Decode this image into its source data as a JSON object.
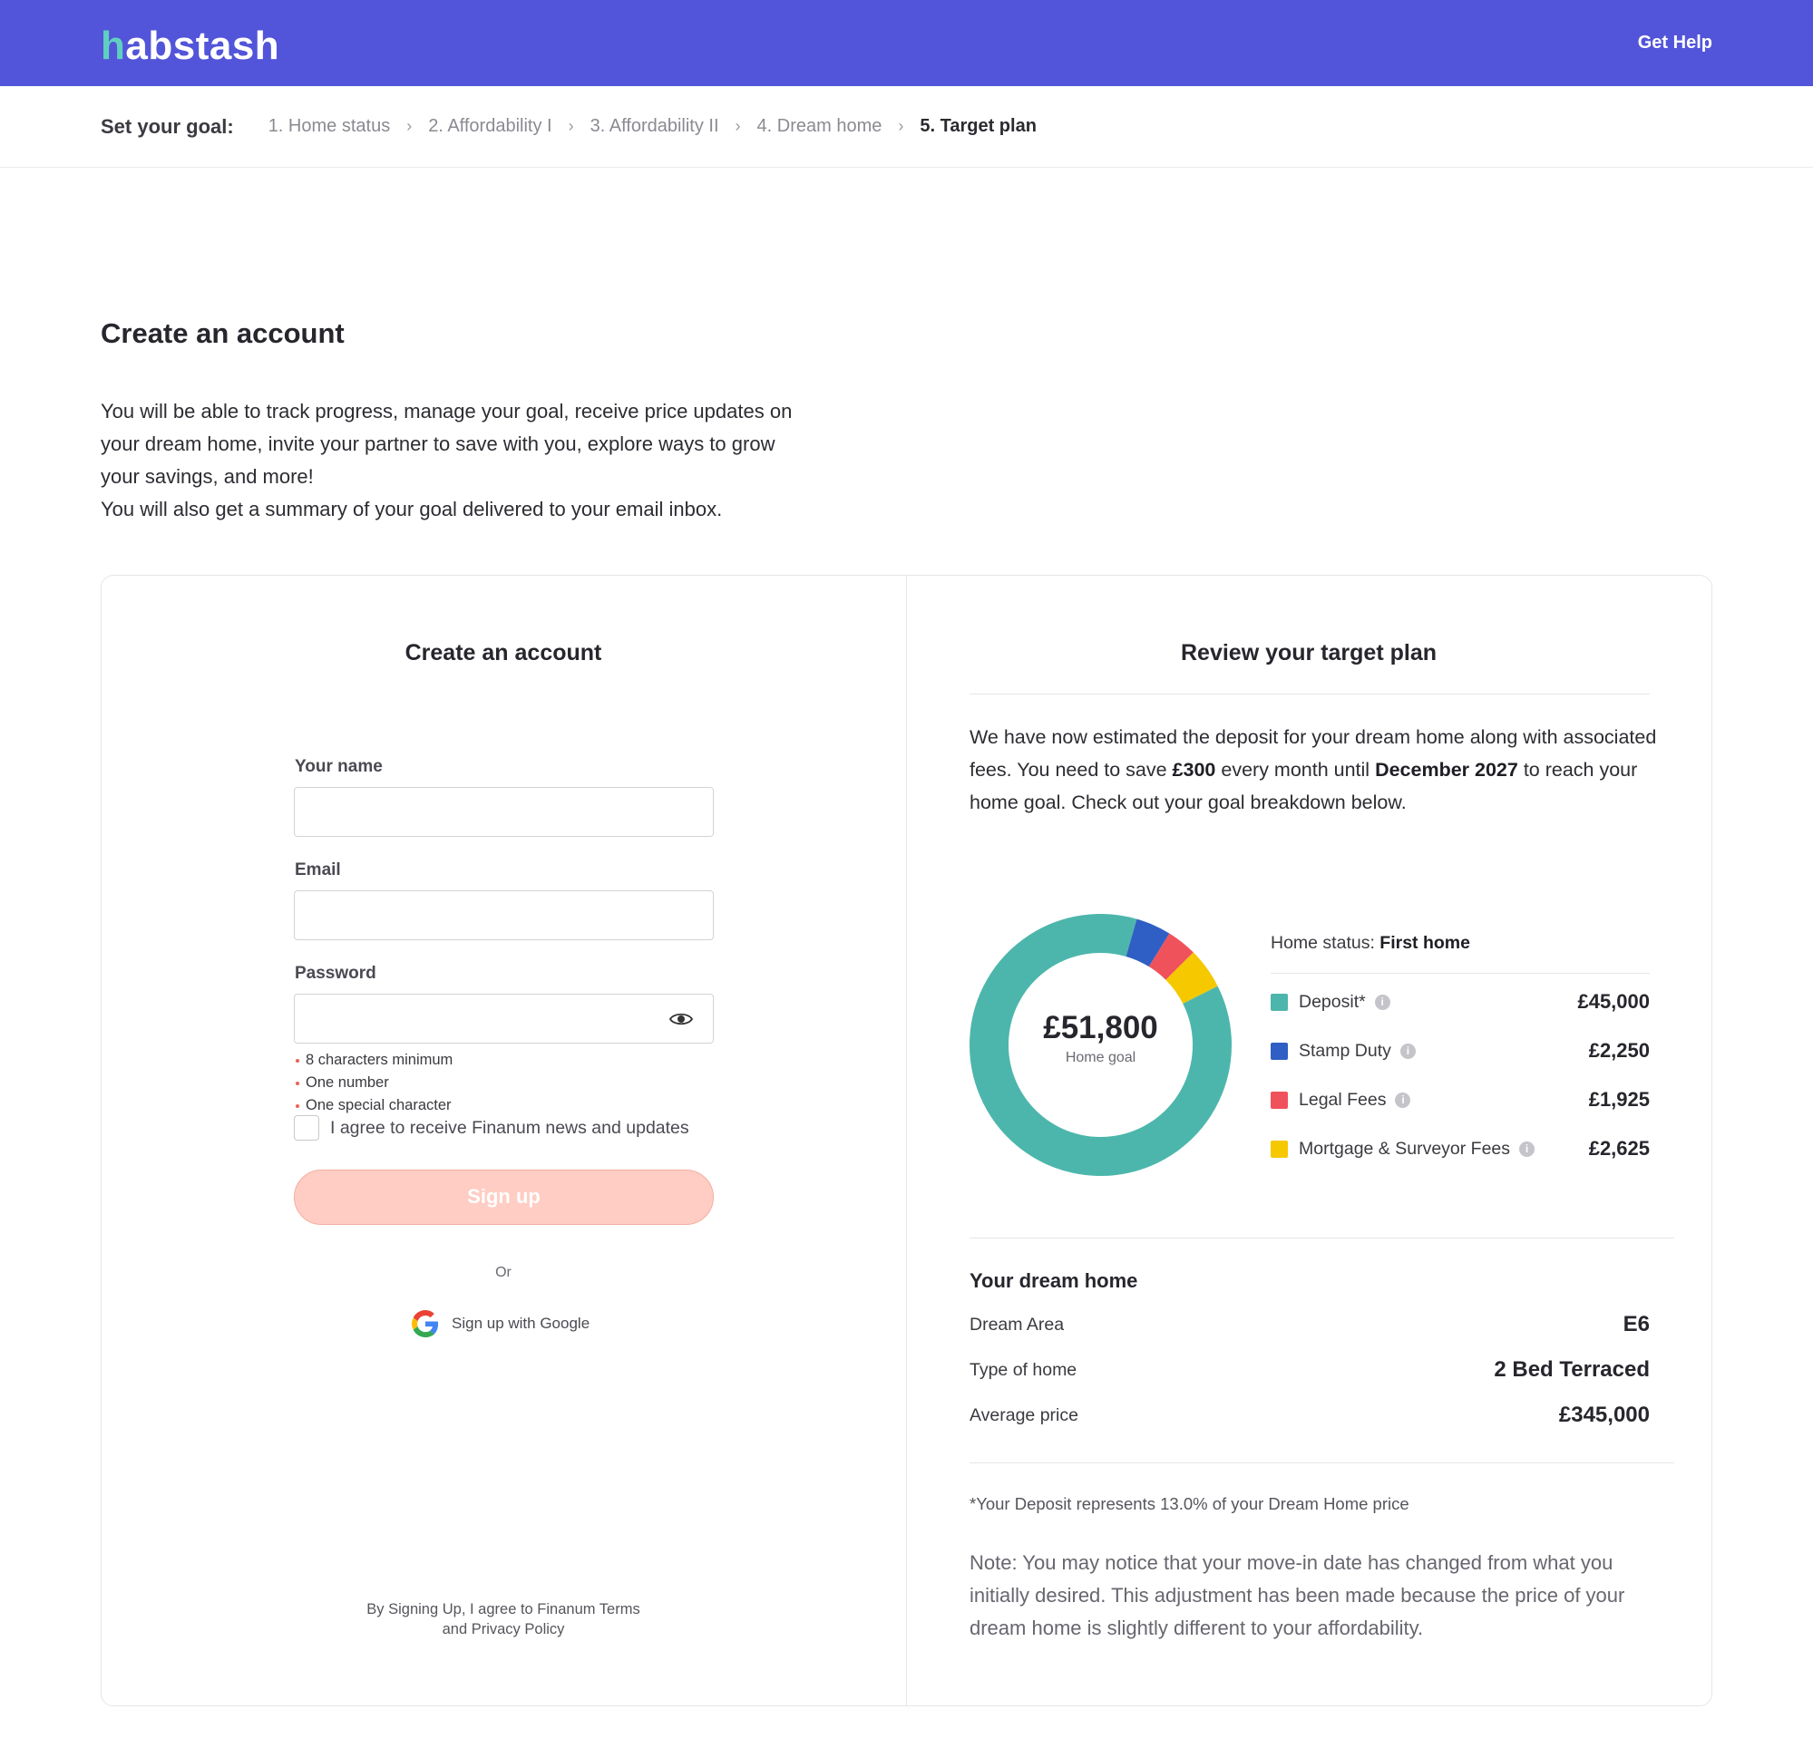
{
  "header": {
    "logo_h": "h",
    "logo_rest": "abstash",
    "get_help": "Get Help"
  },
  "steps": {
    "lead": "Set your goal:",
    "items": [
      {
        "label": "1. Home status"
      },
      {
        "label": "2. Affordability I"
      },
      {
        "label": "3. Affordability II"
      },
      {
        "label": "4. Dream home"
      },
      {
        "label": "5. Target plan"
      }
    ]
  },
  "page": {
    "title": "Create an account",
    "intro_1": "You will be able to track progress, manage your goal, receive price updates on your dream home, invite your partner to save with you, explore ways to grow your savings, and more!",
    "intro_2": "You will also get a summary of your goal delivered to your email inbox."
  },
  "form": {
    "title": "Create an account",
    "name_label": "Your name",
    "name_value": "",
    "email_label": "Email",
    "email_value": "",
    "password_label": "Password",
    "password_value": "",
    "rules": [
      "8 characters minimum",
      "One number",
      "One special character"
    ],
    "agree_label": "I agree to receive Finanum news and updates",
    "signup_label": "Sign up",
    "or_label": "Or",
    "google_label": "Sign up with Google",
    "terms_line1": "By Signing Up, I agree to Finanum Terms",
    "terms_line2": "and Privacy Policy"
  },
  "plan": {
    "title": "Review your target plan",
    "text_1": "We have now estimated the deposit for your dream home along with associated fees. You need to save ",
    "monthly": "£300",
    "text_2": " every month until ",
    "until": "December 2027",
    "text_3": " to reach your home goal. Check out your goal breakdown below.",
    "goal_amount": "£51,800",
    "goal_label": "Home goal",
    "home_status_label": "Home status: ",
    "home_status_value": "First home",
    "breakdown": [
      {
        "name": "Deposit*",
        "value": "£45,000",
        "amount": 45000,
        "color": "#4db6ac"
      },
      {
        "name": "Stamp Duty",
        "value": "£2,250",
        "amount": 2250,
        "color": "#2f5fc4"
      },
      {
        "name": "Legal Fees",
        "value": "£1,925",
        "amount": 1925,
        "color": "#f0525b"
      },
      {
        "name": "Mortgage & Surveyor Fees",
        "value": "£2,625",
        "amount": 2625,
        "color": "#f5c800"
      }
    ],
    "info_glyph": "i"
  },
  "dream": {
    "title": "Your dream home",
    "rows": [
      {
        "key": "Dream Area",
        "value": "E6"
      },
      {
        "key": "Type of home",
        "value": "2 Bed Terraced"
      },
      {
        "key": "Average price",
        "value": "£345,000"
      }
    ],
    "footnote": "*Your Deposit represents 13.0% of your Dream Home price",
    "note": "Note: You may notice that your move-in date has changed from what you initially desired. This adjustment has been made because the price of your dream home is slightly different to your affordability."
  },
  "icons": {
    "eye": "eye-icon",
    "google": "google-icon",
    "chevron": "chevron-right-icon",
    "info": "info-icon"
  },
  "colors": {
    "header": "#5255d9",
    "logo_accent": "#5fd0c0",
    "signup": "#ffcdc3"
  }
}
